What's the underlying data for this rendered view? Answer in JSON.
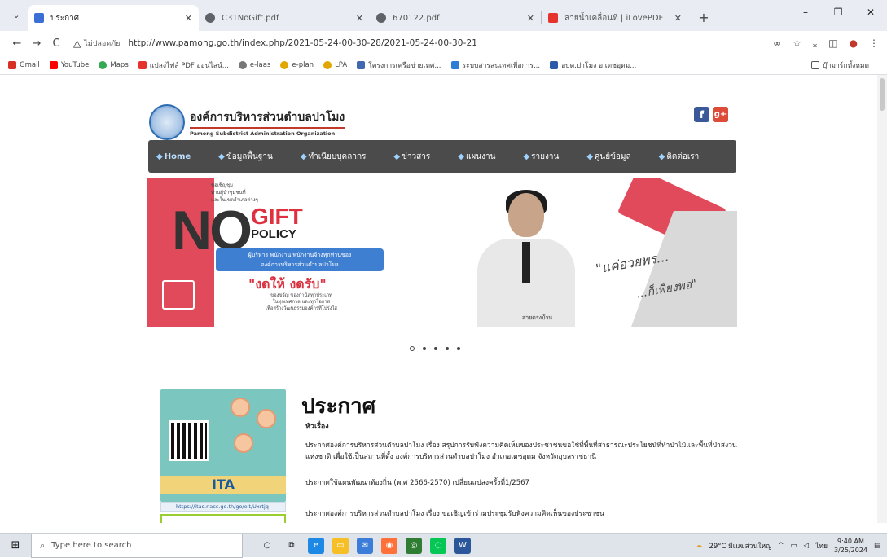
{
  "browser": {
    "tabs": [
      {
        "title": "ประกาศ",
        "color": "#3b6fd6",
        "active": true
      },
      {
        "title": "C31NoGift.pdf",
        "color": "#5f6368",
        "active": false
      },
      {
        "title": "670122.pdf",
        "color": "#5f6368",
        "active": false
      },
      {
        "title": "ลายน้ำเคลื่อนที่ | iLovePDF",
        "color": "#e5322d",
        "active": false
      }
    ],
    "new_tab_symbol": "+",
    "window_controls": {
      "minimize": "–",
      "restore": "❐",
      "close": "✕"
    },
    "nav": {
      "back": "←",
      "forward": "→",
      "reload": "C"
    },
    "insecure_label": "ไม่ปลอดภัย",
    "url": "http://www.pamong.go.th/index.php/2021-05-24-00-30-28/2021-05-24-00-30-21",
    "addr_icons": [
      "∞",
      "☆",
      "⤓",
      "◫",
      "●",
      "⋮"
    ],
    "bookmarks": [
      {
        "label": "Gmail",
        "color": "#d93025"
      },
      {
        "label": "YouTube",
        "color": "#ff0000"
      },
      {
        "label": "Maps",
        "color": "#34a853"
      },
      {
        "label": "แปลงไฟล์ PDF ออนไลน์...",
        "color": "#e5322d"
      },
      {
        "label": "e-laas",
        "color": "#777777"
      },
      {
        "label": "e-plan",
        "color": "#e2a600"
      },
      {
        "label": "LPA",
        "color": "#e2a600"
      },
      {
        "label": "โครงการเครือข่ายเทศ...",
        "color": "#4267b2"
      },
      {
        "label": "ระบบสารสนเทศเพื่อการ...",
        "color": "#2a7fd4"
      },
      {
        "label": "อบต.ปาโมง อ.เดชอุดม...",
        "color": "#2a5aa8"
      }
    ],
    "bookmarks_right": "บุ๊กมาร์กทั้งหมด"
  },
  "site": {
    "title": "องค์การบริหารส่วนตำบลปาโมง",
    "subtitle": "Pamong Subdistrict Administration Organization",
    "social": {
      "facebook": "f",
      "google": "g+"
    },
    "menu": [
      {
        "label": "Home",
        "home": true
      },
      {
        "label": "ข้อมูลพื้นฐาน"
      },
      {
        "label": "ทำเนียบบุคลากร"
      },
      {
        "label": "ข่าวสาร"
      },
      {
        "label": "แผนงาน"
      },
      {
        "label": "รายงาน"
      },
      {
        "label": "ศูนย์ข้อมูล"
      },
      {
        "label": "ติดต่อเรา"
      }
    ],
    "banner": {
      "no": "NO",
      "gift": "GIFT",
      "policy": "POLICY",
      "head_small": "ขอเชิญชุม\nท่านผู้นำชุมชนที่\nและในเขตอำเภอต่างๆ",
      "blue_text": "ผู้บริหาร พนักงาน พนักงานจ้างทุกท่านของ\nองค์การบริหารส่วนตำบลปาโมง",
      "thai_slogan": "\"งดให้ งดรับ\"",
      "thai_sub": "ของขวัญ ของกำนัลทุกประเภท\nในทุกเทศกาล และทุกโอกาส\nเพื่อสร้างวัฒนธรรมองค์กรที่โปร่งใส",
      "quote1": "\"แค่อวยพร...",
      "quote2": "...ก็เพียงพอ\"",
      "bottom_logo": "สายตรงบ้าน"
    },
    "slider_dots": 5,
    "ita_banner": "ITA",
    "ita_link": "https://itas.nacc.go.th/go/eit/Uxrtjq",
    "announce": {
      "title": "ประกาศ",
      "heading": "หัวเรื่อง",
      "items": [
        "ประกาศองค์การบริหารส่วนตำบลปาโมง เรื่อง สรุปการรับฟังความคิดเห็นของประชาชนขอใช้ที่พื้นที่สาธารณะประโยชน์ที่ทำป่าไม้และพื้นที่ป่าสงวนแห่งชาติ เพื่อใช้เป็นสถานที่ตั้ง องค์การบริหารส่วนตำบลปาโมง อำเภอเดชอุดม จังหวัดอุบลราชธานี",
        "ประกาศใช้แผนพัฒนาท้องถิ่น (พ.ศ 2566-2570) เปลี่ยนแปลงครั้งที่1/2567",
        "ประกาศองค์การบริหารส่วนตำบลปาโมง เรื่อง ขอเชิญเข้าร่วมประชุมรับฟังความคิดเห็นของประชาชน"
      ]
    }
  },
  "taskbar": {
    "search_placeholder": "Type here to search",
    "weather": "29°C มีเมฆส่วนใหญ่",
    "lang": "ไทย",
    "time": "9:40 AM",
    "date": "3/25/2024"
  }
}
